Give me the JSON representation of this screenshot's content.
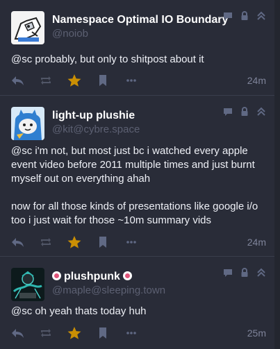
{
  "icons": {
    "reply": "reply-icon",
    "boost": "boost-icon",
    "favourite": "star-icon",
    "bookmark": "bookmark-icon",
    "more": "ellipsis-icon",
    "reply_count": "speech-bubble-icon",
    "visibility": "lock-icon",
    "collapse": "double-chevron-up-icon"
  },
  "colors": {
    "background": "#292c38",
    "favourite_active": "#ca8f04",
    "muted_icon": "#606984",
    "handle": "#5c6072"
  },
  "statuses": [
    {
      "display_name": "Namespace Optimal IO Boundary",
      "handle": "@noiob",
      "content": [
        "@sc probably, but only to shitpost about it"
      ],
      "time": "24m",
      "favourited": true
    },
    {
      "display_name": "light-up plushie",
      "handle": "@kit@cybre.space",
      "content": [
        "@sc i'm not, but most just bc i watched every apple event video before 2011 multiple times and just burnt myself out on everything ahah",
        "now for all those kinds of presentations like google i/o too i just wait for those ~10m summary vids"
      ],
      "time": "24m",
      "favourited": true
    },
    {
      "display_name": "plushpunk",
      "handle": "@maple@sleeping.town",
      "content": [
        "@sc oh yeah thats today huh"
      ],
      "time": "25m",
      "favourited": true
    }
  ]
}
